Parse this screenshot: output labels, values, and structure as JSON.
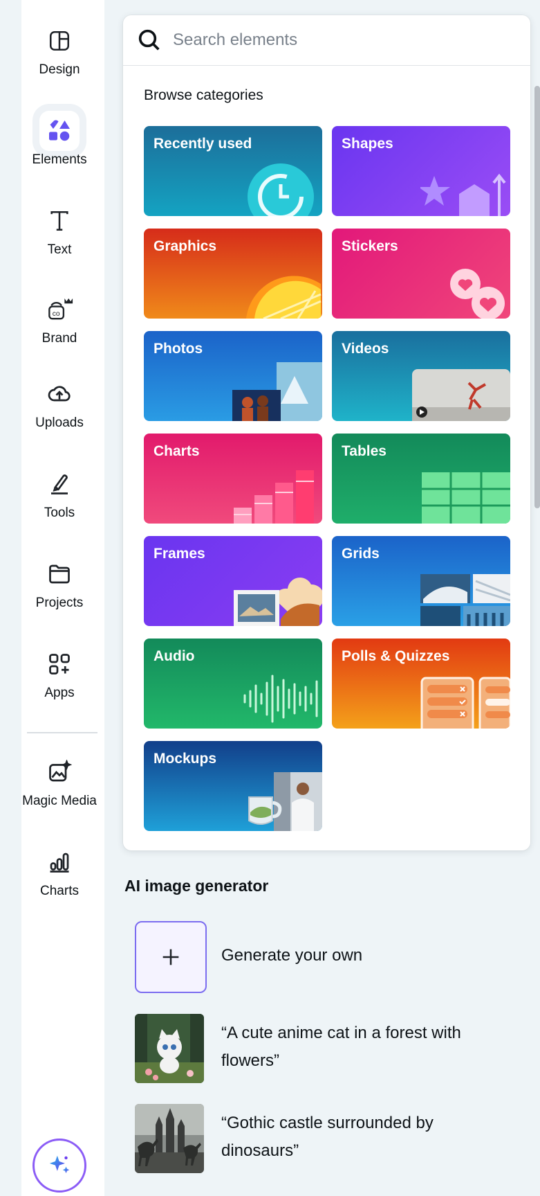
{
  "sidebar": {
    "items": [
      {
        "label": "Design",
        "icon": "layout-icon"
      },
      {
        "label": "Elements",
        "icon": "elements-icon"
      },
      {
        "label": "Text",
        "icon": "text-icon"
      },
      {
        "label": "Brand",
        "icon": "brand-icon"
      },
      {
        "label": "Uploads",
        "icon": "cloud-upload-icon"
      },
      {
        "label": "Tools",
        "icon": "pen-icon"
      },
      {
        "label": "Projects",
        "icon": "folder-icon"
      },
      {
        "label": "Apps",
        "icon": "apps-icon"
      },
      {
        "label": "Magic Media",
        "icon": "magic-image-icon"
      },
      {
        "label": "Charts",
        "icon": "bar-chart-icon"
      }
    ],
    "active": "Elements"
  },
  "search": {
    "placeholder": "Search elements"
  },
  "browse": {
    "title": "Browse categories",
    "categories": [
      {
        "label": "Recently used"
      },
      {
        "label": "Shapes"
      },
      {
        "label": "Graphics"
      },
      {
        "label": "Stickers"
      },
      {
        "label": "Photos"
      },
      {
        "label": "Videos"
      },
      {
        "label": "Charts"
      },
      {
        "label": "Tables"
      },
      {
        "label": "Frames"
      },
      {
        "label": "Grids"
      },
      {
        "label": "Audio"
      },
      {
        "label": "Polls & Quizzes"
      },
      {
        "label": "Mockups"
      }
    ]
  },
  "ai_generator": {
    "title": "AI image generator",
    "generate_label": "Generate your own",
    "prompts": [
      {
        "line1": "“A cute anime cat in a forest with",
        "line2": "flowers”"
      },
      {
        "line1": "“Gothic castle surrounded by",
        "line2": "dinosaurs”"
      }
    ]
  },
  "colors": {
    "accent": "#8b5cf6",
    "brand": "#6453f0"
  }
}
